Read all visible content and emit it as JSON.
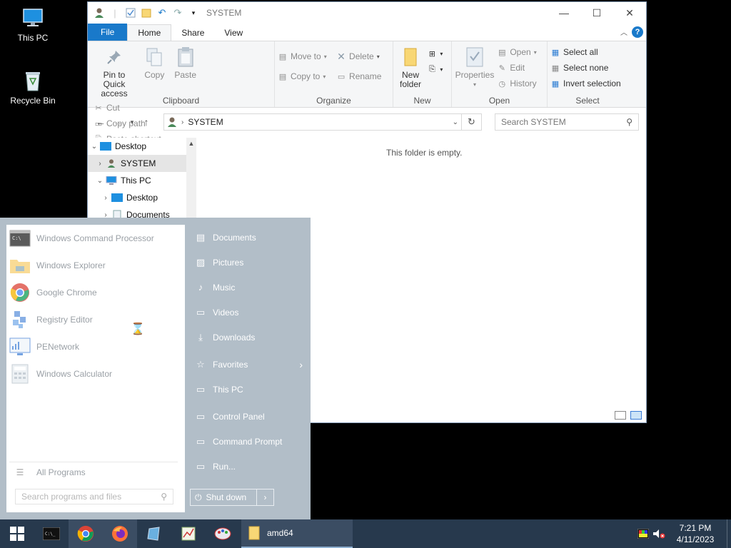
{
  "desktop": {
    "icons": [
      {
        "label": "This PC"
      },
      {
        "label": "Recycle Bin"
      }
    ]
  },
  "explorer": {
    "title": "SYSTEM",
    "ribbon_tabs": [
      "File",
      "Home",
      "Share",
      "View"
    ],
    "clipboard": {
      "pin": "Pin to Quick access",
      "copy": "Copy",
      "paste": "Paste",
      "cut": "Cut",
      "copy_path": "Copy path",
      "paste_shortcut": "Paste shortcut",
      "group": "Clipboard"
    },
    "organize": {
      "move_to": "Move to",
      "copy_to": "Copy to",
      "delete": "Delete",
      "rename": "Rename",
      "group": "Organize"
    },
    "new": {
      "new_folder": "New folder",
      "group": "New"
    },
    "open": {
      "properties": "Properties",
      "open": "Open",
      "edit": "Edit",
      "history": "History",
      "group": "Open"
    },
    "select": {
      "select_all": "Select all",
      "select_none": "Select none",
      "invert": "Invert selection",
      "group": "Select"
    },
    "address": {
      "crumb": "SYSTEM"
    },
    "search": {
      "placeholder": "Search SYSTEM"
    },
    "tree": [
      {
        "label": "Desktop"
      },
      {
        "label": "SYSTEM"
      },
      {
        "label": "This PC"
      },
      {
        "label": "Desktop"
      },
      {
        "label": "Documents"
      }
    ],
    "empty_message": "This folder is empty."
  },
  "startmenu": {
    "programs": [
      {
        "label": "Windows Command Processor"
      },
      {
        "label": "Windows Explorer"
      },
      {
        "label": "Google Chrome"
      },
      {
        "label": "Registry Editor"
      },
      {
        "label": "PENetwork"
      },
      {
        "label": "Windows Calculator"
      }
    ],
    "all_programs": "All Programs",
    "search_placeholder": "Search programs and files",
    "right_items": [
      {
        "label": "Documents"
      },
      {
        "label": "Pictures"
      },
      {
        "label": "Music"
      },
      {
        "label": "Videos"
      },
      {
        "label": "Downloads"
      },
      {
        "label": "Favorites"
      },
      {
        "label": "This PC"
      },
      {
        "label": "Control Panel"
      },
      {
        "label": "Command Prompt"
      },
      {
        "label": "Run..."
      }
    ],
    "shutdown": "Shut down"
  },
  "taskbar": {
    "folder_label": "amd64",
    "time": "7:21 PM",
    "date": "4/11/2023"
  },
  "colors": {
    "taskbar": "#27394d",
    "startmenu_right": "#b2bec8",
    "ribbon_file": "#1979ca"
  }
}
